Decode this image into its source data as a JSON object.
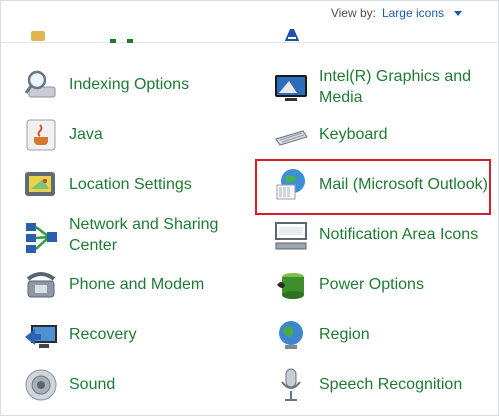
{
  "header": {
    "view_by_label": "View by:",
    "view_by_value": "Large icons"
  },
  "items": {
    "indexing": "Indexing Options",
    "intel": "Intel(R) Graphics and Media",
    "java": "Java",
    "keyboard": "Keyboard",
    "location": "Location Settings",
    "mail": "Mail (Microsoft Outlook)",
    "network": "Network and Sharing Center",
    "notification": "Notification Area Icons",
    "phone": "Phone and Modem",
    "power": "Power Options",
    "recovery": "Recovery",
    "region": "Region",
    "sound": "Sound",
    "speech": "Speech Recognition"
  },
  "highlight": {
    "color": "#d71f2b"
  },
  "icons": {
    "indexing": "magnifier-over-drive-icon",
    "intel": "monitor-icon",
    "java": "java-cup-icon",
    "keyboard": "keyboard-icon",
    "location": "gps-device-icon",
    "mail": "mail-globe-icon",
    "network": "network-computers-icon",
    "notification": "notification-area-icon",
    "phone": "telephone-icon",
    "power": "battery-icon",
    "recovery": "recovery-computer-icon",
    "region": "globe-icon",
    "sound": "speaker-icon",
    "speech": "microphone-icon"
  }
}
